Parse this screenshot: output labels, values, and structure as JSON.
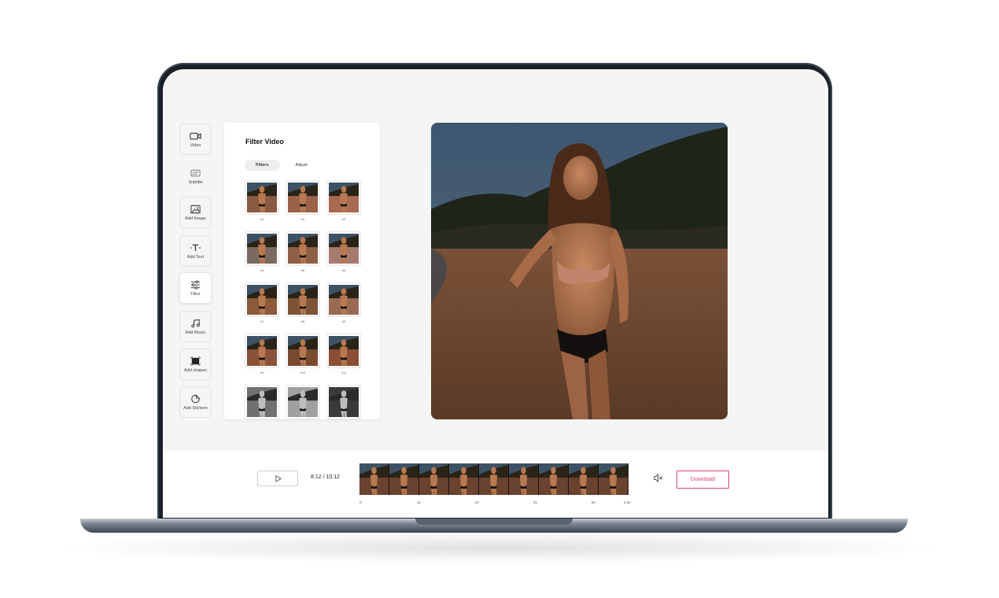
{
  "sidebar": {
    "items": [
      {
        "label": "Video",
        "icon": "video-camera-icon"
      },
      {
        "label": "Subtitle",
        "icon": "subtitle-icon"
      },
      {
        "label": "Add Image",
        "icon": "image-icon"
      },
      {
        "label": "Add Text",
        "icon": "text-icon"
      },
      {
        "label": "Filter",
        "icon": "sliders-icon",
        "active": true
      },
      {
        "label": "Add Music",
        "icon": "music-note-icon"
      },
      {
        "label": "Add shapes",
        "icon": "shape-square-icon"
      },
      {
        "label": "Add Stickers",
        "icon": "sticker-icon"
      }
    ]
  },
  "filter_panel": {
    "title": "Filter Video",
    "tabs": [
      {
        "label": "Filters",
        "active": true
      },
      {
        "label": "Adjust",
        "active": false
      }
    ],
    "filters": [
      {
        "label": "#1",
        "tone": "#8a5a42"
      },
      {
        "label": "#2",
        "tone": "#9b6247"
      },
      {
        "label": "#3",
        "tone": "#a86a52"
      },
      {
        "label": "#4",
        "tone": "#7a6a60"
      },
      {
        "label": "#5",
        "tone": "#8f5e46"
      },
      {
        "label": "#6",
        "tone": "#a77a70"
      },
      {
        "label": "#7",
        "tone": "#8c5b3c"
      },
      {
        "label": "#8",
        "tone": "#7e5436"
      },
      {
        "label": "#9",
        "tone": "#9a6a55"
      },
      {
        "label": "#9",
        "tone": "#8a5238"
      },
      {
        "label": "#10",
        "tone": "#7a4a30"
      },
      {
        "label": "#11",
        "tone": "#8a4f34"
      },
      {
        "label": "",
        "tone": "#707070"
      },
      {
        "label": "",
        "tone": "#a0a0a0"
      },
      {
        "label": "",
        "tone": "#3a3a3a"
      }
    ]
  },
  "player": {
    "time": "8:12 / 10:12",
    "ticks": [
      "0",
      "1s",
      "2s",
      "3s",
      "5s",
      "4.3s"
    ],
    "download_label": "Download"
  },
  "colors": {
    "accent": "#e0447a",
    "frame": "#1b2027"
  }
}
